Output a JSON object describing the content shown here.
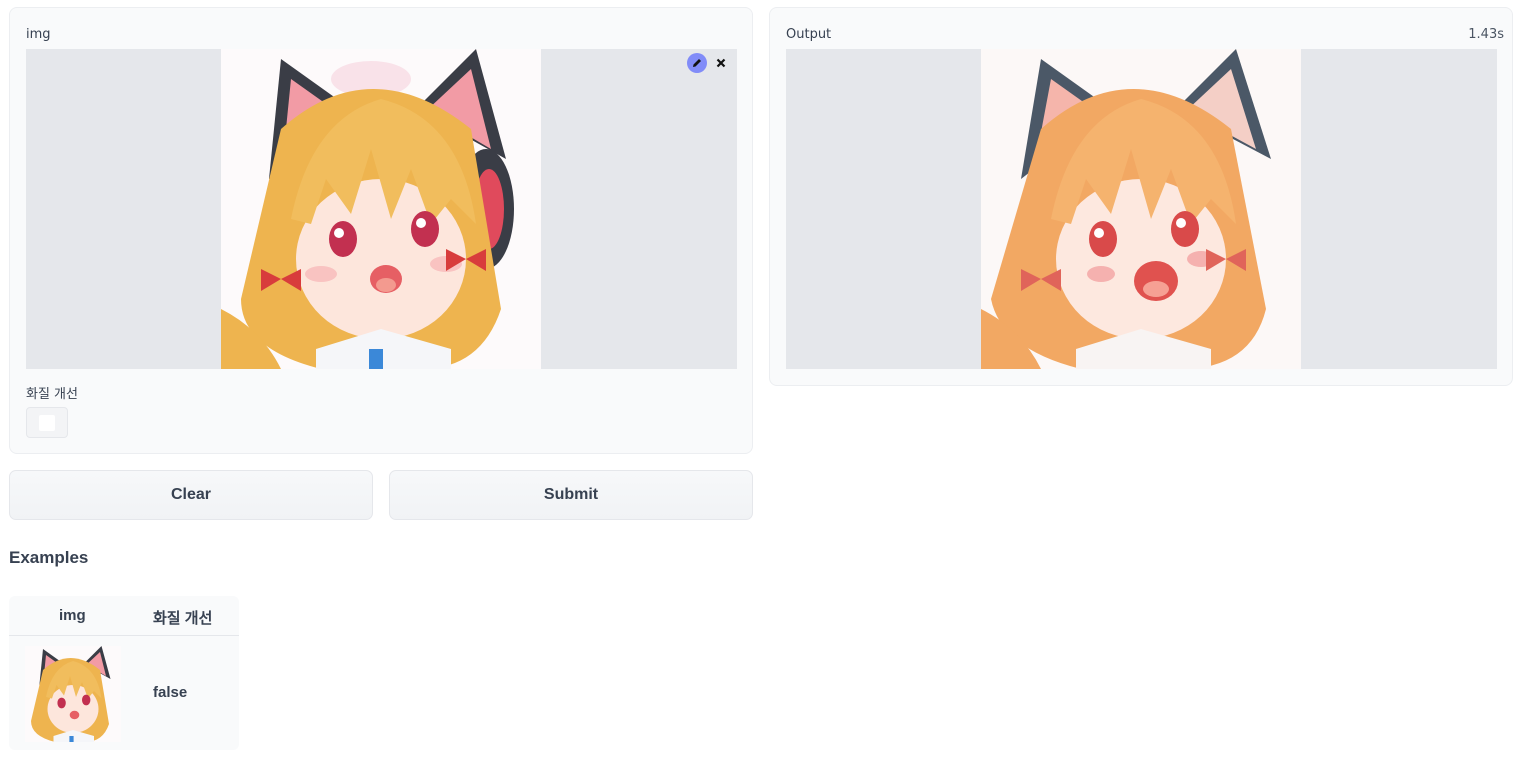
{
  "input_panel": {
    "label": "img",
    "edit_icon": "pencil-icon",
    "clear_icon": "close-icon",
    "checkbox_label": "화질 개선",
    "checkbox_checked": false
  },
  "output_panel": {
    "label": "Output",
    "time": "1.43s"
  },
  "buttons": {
    "clear": "Clear",
    "submit": "Submit"
  },
  "examples": {
    "title": "Examples",
    "headers": [
      "img",
      "화질 개선"
    ],
    "rows": [
      {
        "img": "anime-girl-thumbnail",
        "enhance": "false"
      }
    ]
  },
  "colors": {
    "edit_button": "#818cf8",
    "panel_bg": "#f9fafb",
    "image_placeholder": "#e5e7eb"
  }
}
